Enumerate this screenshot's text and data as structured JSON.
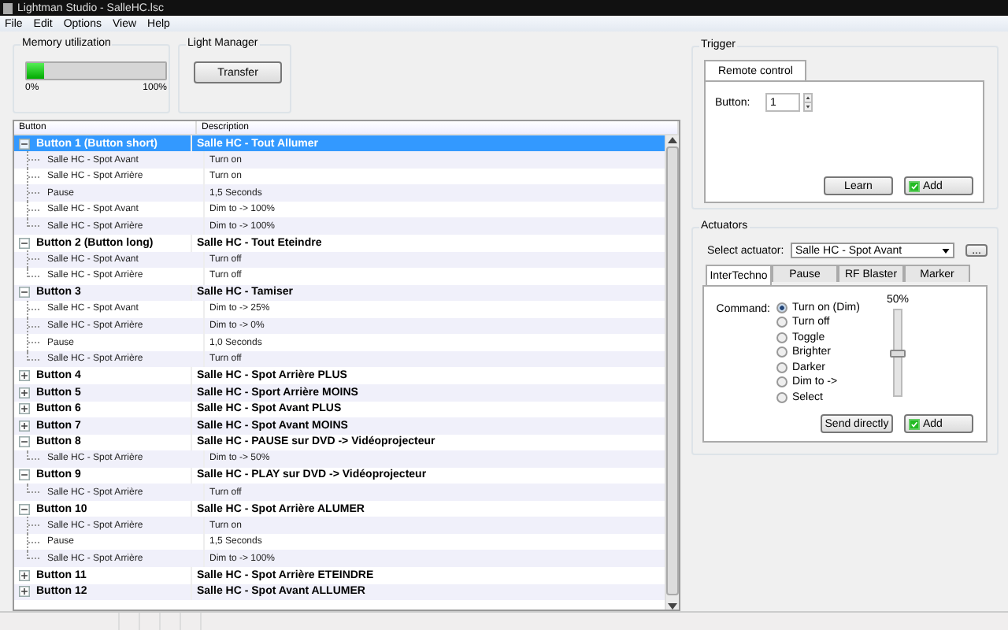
{
  "window": {
    "title": "Lightman Studio - SalleHC.lsc"
  },
  "menu": [
    "File",
    "Edit",
    "Options",
    "View",
    "Help"
  ],
  "memory": {
    "label": "Memory utilization",
    "level": 0.12,
    "min": "0%",
    "max": "100%"
  },
  "light_manager": {
    "label": "Light Manager",
    "button": "Transfer"
  },
  "table": {
    "columns": [
      "Button",
      "Description"
    ],
    "rows": [
      {
        "button": "Button 1 (Button short)",
        "description": "Salle HC - Tout Allumer",
        "expanded": true,
        "selected": true,
        "children": [
          {
            "button": "Salle HC - Spot Avant",
            "description": "Turn on"
          },
          {
            "button": "Salle HC - Spot Arrière",
            "description": "Turn on"
          },
          {
            "button": "Pause",
            "description": "1,5 Seconds"
          },
          {
            "button": "Salle HC - Spot Avant",
            "description": "Dim to -> 100%"
          },
          {
            "button": "Salle HC - Spot Arrière",
            "description": "Dim to -> 100%"
          }
        ]
      },
      {
        "button": "Button 2 (Button long)",
        "description": "Salle HC - Tout Eteindre",
        "expanded": true,
        "selected": false,
        "children": [
          {
            "button": "Salle HC - Spot Avant",
            "description": "Turn off"
          },
          {
            "button": "Salle HC - Spot Arrière",
            "description": "Turn off"
          }
        ]
      },
      {
        "button": "Button 3",
        "description": "Salle HC - Tamiser",
        "expanded": true,
        "selected": false,
        "children": [
          {
            "button": "Salle HC - Spot Avant",
            "description": "Dim to -> 25%"
          },
          {
            "button": "Salle HC - Spot Arrière",
            "description": "Dim to -> 0%"
          },
          {
            "button": "Pause",
            "description": "1,0 Seconds"
          },
          {
            "button": "Salle HC - Spot Arrière",
            "description": "Turn off"
          }
        ]
      },
      {
        "button": "Button 4",
        "description": "Salle HC - Spot Arrière PLUS",
        "expanded": false,
        "selected": false
      },
      {
        "button": "Button 5",
        "description": "Salle HC - Sport Arrière MOINS",
        "expanded": false,
        "selected": false
      },
      {
        "button": "Button 6",
        "description": "Salle HC - Spot Avant PLUS",
        "expanded": false,
        "selected": false
      },
      {
        "button": "Button 7",
        "description": "Salle HC - Spot Avant MOINS",
        "expanded": false,
        "selected": false
      },
      {
        "button": "Button 8",
        "description": "Salle HC - PAUSE sur DVD -> Vidéoprojecteur",
        "expanded": true,
        "selected": false,
        "children": [
          {
            "button": "Salle HC - Spot Arrière",
            "description": "Dim to -> 50%"
          }
        ]
      },
      {
        "button": "Button 9",
        "description": "Salle HC - PLAY sur DVD -> Vidéoprojecteur",
        "expanded": true,
        "selected": false,
        "children": [
          {
            "button": "Salle HC - Spot Arrière",
            "description": "Turn off"
          }
        ]
      },
      {
        "button": "Button 10",
        "description": "Salle HC - Spot Arrière ALUMER",
        "expanded": true,
        "selected": false,
        "children": [
          {
            "button": "Salle HC - Spot Arrière",
            "description": "Turn on"
          },
          {
            "button": "Pause",
            "description": "1,5 Seconds"
          },
          {
            "button": "Salle HC - Spot Arrière",
            "description": "Dim to -> 100%"
          }
        ]
      },
      {
        "button": "Button 11",
        "description": "Salle HC - Spot Arrière ETEINDRE",
        "expanded": false,
        "selected": false
      },
      {
        "button": "Button 12",
        "description": "Salle HC - Spot Avant ALLUMER",
        "expanded": false,
        "selected": false
      }
    ]
  },
  "trigger": {
    "label": "Trigger",
    "tabs": [
      {
        "label": "Remote control",
        "selected": true
      }
    ],
    "field_label": "Button:",
    "value": "1",
    "buttons": [
      {
        "label": "Learn",
        "kind": "plain"
      },
      {
        "label": "Add",
        "kind": "check"
      }
    ]
  },
  "actuators": {
    "label": "Actuators",
    "select_label": "Select actuator:",
    "select_value": "Salle HC - Spot Avant",
    "more_button": "...",
    "tabs": [
      {
        "label": "InterTechno",
        "selected": true
      },
      {
        "label": "Pause",
        "selected": false
      },
      {
        "label": "RF Blaster",
        "selected": false
      },
      {
        "label": "Marker",
        "selected": false
      }
    ],
    "command_label": "Command:",
    "commands": [
      {
        "label": "Turn on (Dim)",
        "selected": true
      },
      {
        "label": "Turn off",
        "selected": false
      },
      {
        "label": "Toggle",
        "selected": false
      },
      {
        "label": "Brighter",
        "selected": false
      },
      {
        "label": "Darker",
        "selected": false
      },
      {
        "label": "Dim to ->",
        "selected": false
      },
      {
        "label": "Select",
        "selected": false
      }
    ],
    "slider": {
      "reading": "50%",
      "level": 0.5
    },
    "buttons": [
      {
        "label": "Send directly",
        "kind": "plain"
      },
      {
        "label": "Add",
        "kind": "check"
      }
    ]
  }
}
